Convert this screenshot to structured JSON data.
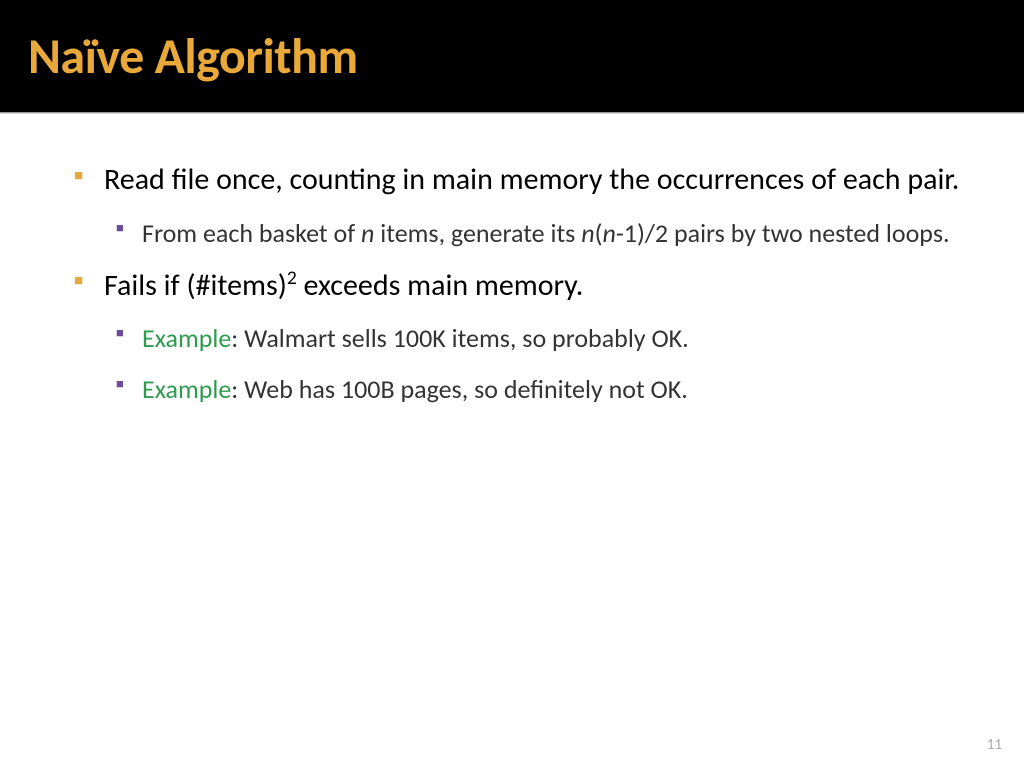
{
  "title": "Naïve Algorithm",
  "bullets": {
    "b1": "Read file once, counting in main memory the occurrences of each pair.",
    "b1_sub_pre": "From each basket of ",
    "b1_sub_n1": "n",
    "b1_sub_mid": " items, generate its ",
    "b1_sub_n2": "n",
    "b1_sub_paren": "(",
    "b1_sub_n3": "n",
    "b1_sub_tail": "-1)/2 pairs by two nested loops.",
    "b2_pre": "Fails if (#items)",
    "b2_sup": "2",
    "b2_post": " exceeds main memory.",
    "ex_label": "Example",
    "ex1_text": ": Walmart sells 100K items, so probably OK.",
    "ex2_text": ": Web has 100B pages, so definitely not OK."
  },
  "page_number": "11"
}
